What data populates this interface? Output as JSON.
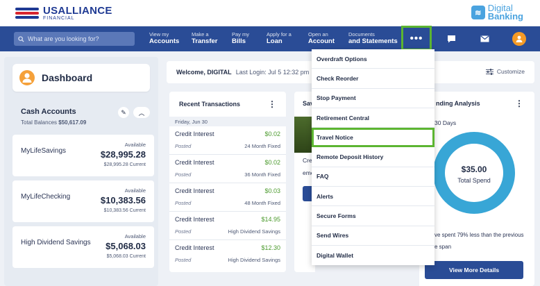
{
  "brand": {
    "name": "USALLIANCE",
    "sub": "FINANCIAL",
    "product_l1": "Digital",
    "product_l2": "Banking"
  },
  "nav": {
    "search_placeholder": "What are you looking for?",
    "items": [
      {
        "l1": "View my",
        "l2": "Accounts"
      },
      {
        "l1": "Make a",
        "l2": "Transfer"
      },
      {
        "l1": "Pay my",
        "l2": "Bills"
      },
      {
        "l1": "Apply for a",
        "l2": "Loan"
      },
      {
        "l1": "Open an",
        "l2": "Account"
      },
      {
        "l1": "Documents",
        "l2": "and Statements"
      }
    ],
    "more_label": "•••"
  },
  "sidebar": {
    "title": "Dashboard",
    "cash_title": "Cash Accounts",
    "total_label": "Total Balances",
    "total_value": "$50,617.09",
    "accounts": [
      {
        "name": "MyLifeSavings",
        "available": "Available",
        "balance": "$28,995.28",
        "current": "$28,995.28 Current"
      },
      {
        "name": "MyLifeChecking",
        "available": "Available",
        "balance": "$10,383.56",
        "current": "$10,383.56 Current"
      },
      {
        "name": "High Dividend Savings",
        "available": "Available",
        "balance": "$5,068.03",
        "current": "$5,068.03 Current"
      }
    ]
  },
  "welcome": {
    "greeting": "Welcome, DIGITAL",
    "last_login": "Last Login: Jul 5 12:32 pm",
    "customize": "Customize"
  },
  "transactions": {
    "title": "Recent Transactions",
    "date": "Friday, Jun 30",
    "rows": [
      {
        "name": "Credit Interest",
        "amount": "$0.02",
        "status": "Posted",
        "account": "24 Month Fixed"
      },
      {
        "name": "Credit Interest",
        "amount": "$0.02",
        "status": "Posted",
        "account": "36 Month Fixed"
      },
      {
        "name": "Credit Interest",
        "amount": "$0.03",
        "status": "Posted",
        "account": "48 Month Fixed"
      },
      {
        "name": "Credit Interest",
        "amount": "$14.95",
        "status": "Posted",
        "account": "High Dividend Savings"
      },
      {
        "name": "Credit Interest",
        "amount": "$12.30",
        "status": "Posted",
        "account": "High Dividend Savings"
      }
    ]
  },
  "savings": {
    "title": "Sav",
    "t1": "Cre",
    "t2": "eme"
  },
  "spending": {
    "title": "nding Analysis",
    "period": "30 Days",
    "amount": "$35.00",
    "amount_label": "Total Spend",
    "note1": "ve spent 79% less than the previous",
    "note2": "e span",
    "button": "View More Details"
  },
  "menu": {
    "items": [
      "Overdraft Options",
      "Check Reorder",
      "Stop Payment",
      "Retirement Central",
      "Travel Notice",
      "Remote Deposit History",
      "FAQ",
      "Alerts",
      "Secure Forms",
      "Send Wires",
      "Digital Wallet"
    ],
    "highlighted": "Travel Notice"
  },
  "colors": {
    "nav": "#2a4c96",
    "highlight": "#5cb531",
    "donut": "#38a6d6",
    "accent": "#f59a25"
  }
}
